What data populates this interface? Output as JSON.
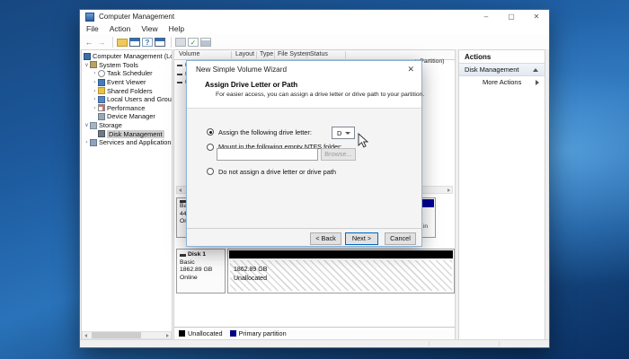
{
  "window": {
    "title": "Computer Management",
    "controls": {
      "minimize": "–",
      "maximize": "▢",
      "close": "✕"
    },
    "menu": [
      "File",
      "Action",
      "View",
      "Help"
    ],
    "toolbar": {
      "back": "←",
      "forward": "→",
      "help": "?",
      "check": "✓"
    }
  },
  "tree": {
    "items": [
      {
        "label": "Computer Management (Local",
        "expander": "",
        "icon": "computer-icon",
        "selected": false
      },
      {
        "label": "System Tools",
        "expander": "∨",
        "icon": "tools-icon",
        "selected": false
      },
      {
        "label": "Task Scheduler",
        "expander": "›",
        "icon": "scheduler-icon",
        "selected": false
      },
      {
        "label": "Event Viewer",
        "expander": "›",
        "icon": "event-viewer-icon",
        "selected": false
      },
      {
        "label": "Shared Folders",
        "expander": "›",
        "icon": "folder-icon",
        "selected": false
      },
      {
        "label": "Local Users and Groups",
        "expander": "›",
        "icon": "users-icon",
        "selected": false
      },
      {
        "label": "Performance",
        "expander": "›",
        "icon": "performance-icon",
        "selected": false
      },
      {
        "label": "Device Manager",
        "expander": "",
        "icon": "device-icon",
        "selected": false
      },
      {
        "label": "Storage",
        "expander": "∨",
        "icon": "storage-icon",
        "selected": false
      },
      {
        "label": "Disk Management",
        "expander": "",
        "icon": "disk-icon",
        "selected": true
      },
      {
        "label": "Services and Applications",
        "expander": "›",
        "icon": "services-icon",
        "selected": false
      }
    ]
  },
  "volume_list": {
    "columns": [
      "Volume",
      "Layout",
      "Type",
      "File System",
      "Status"
    ],
    "left_fragments": [
      "(",
      "(",
      "("
    ],
    "right_fragment": "y Partition)"
  },
  "graphical_view": {
    "disk0": {
      "fragments": [
        "Ba",
        "44",
        "On"
      ],
      "body_fragment": "in",
      "band_color": "#000096"
    },
    "disk1": {
      "name": "Disk 1",
      "type": "Basic",
      "size": "1862.89 GB",
      "status": "Online",
      "band_color": "#000000",
      "partition": {
        "size": "1862.89 GB",
        "state": "Unallocated"
      }
    },
    "legend": [
      {
        "label": "Unallocated",
        "color": "#000000"
      },
      {
        "label": "Primary partition",
        "color": "#000080"
      }
    ]
  },
  "actions_panel": {
    "title": "Actions",
    "section": "Disk Management",
    "item": "More Actions"
  },
  "wizard": {
    "title": "New Simple Volume Wizard",
    "close": "✕",
    "heading": "Assign Drive Letter or Path",
    "subtitle": "For easier access, you can assign a drive letter or drive path to your partition.",
    "radio_assign": "Assign the following drive letter:",
    "drive_letter": "D",
    "radio_mount": "Mount in the following empty NTFS folder:",
    "mount_path_value": "",
    "browse_label": "Browse...",
    "radio_none": "Do not assign a drive letter or drive path",
    "back_label": "< Back",
    "next_label": "Next >",
    "cancel_label": "Cancel"
  }
}
